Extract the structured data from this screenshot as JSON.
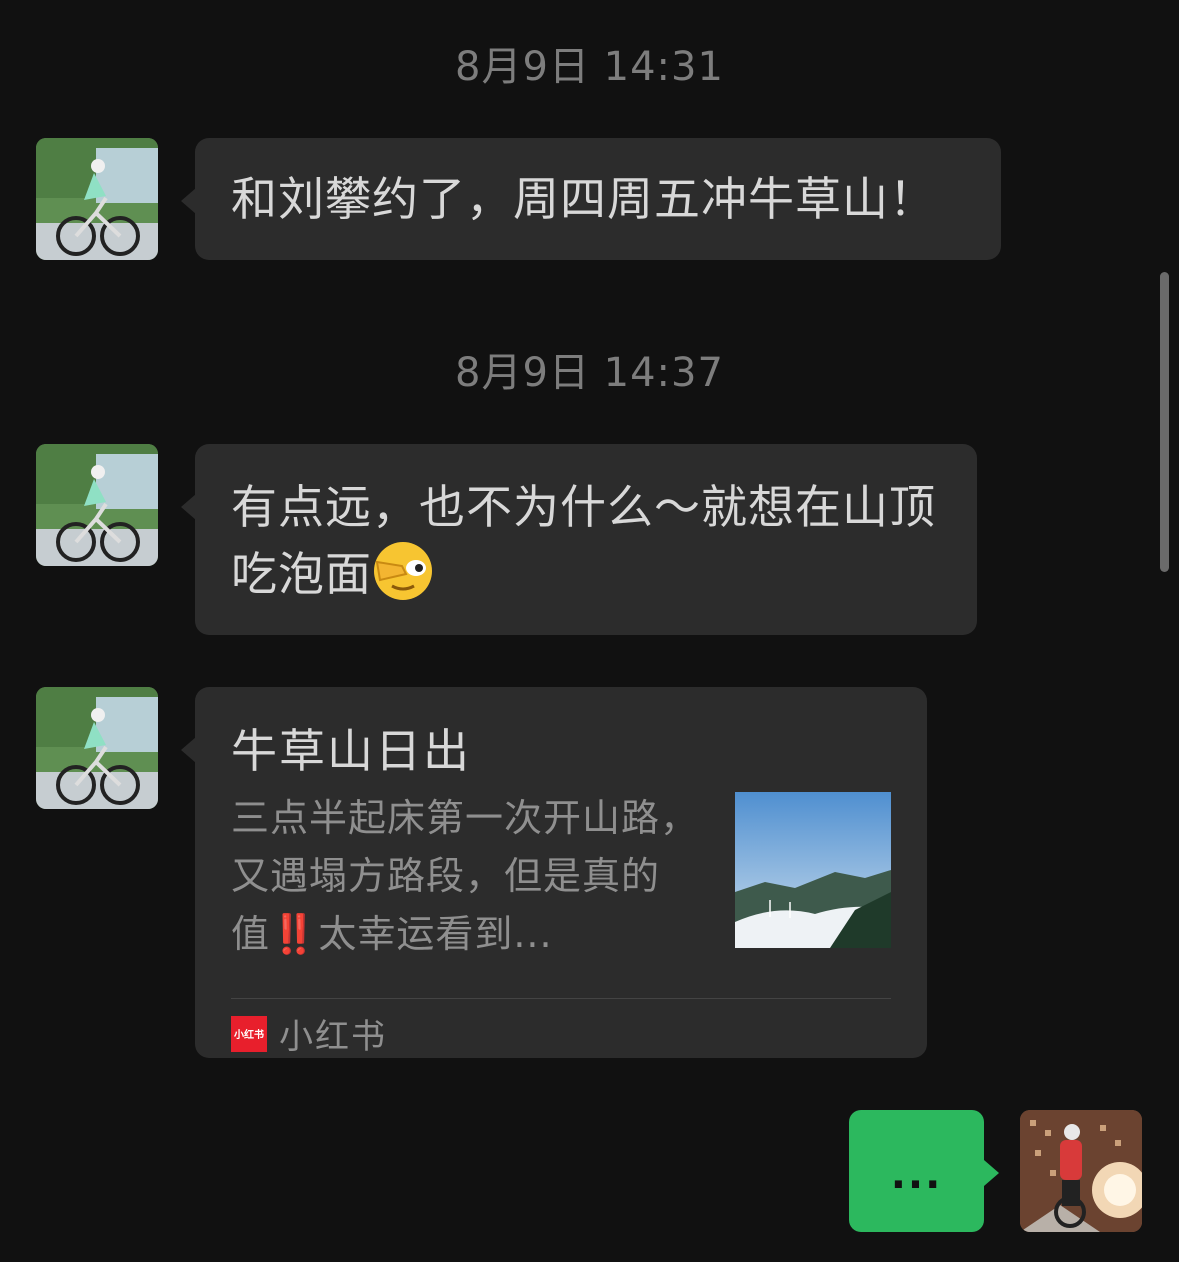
{
  "messages": [
    {
      "timestamp": "8月9日 14:31",
      "text": "和刘攀约了，周四周五冲牛草山！"
    },
    {
      "timestamp": "8月9日 14:37",
      "text": "有点远，也不为什么～就想在山顶吃泡面",
      "emoji": "face-with-hand-over-eye"
    },
    {
      "card": {
        "title": "牛草山日出",
        "desc_before": "三点半起床第一次开山路，又遇塌方路段，但是真的值",
        "desc_mark": "‼️",
        "desc_after": "太幸运看到...",
        "source_logo": "小红书",
        "source_name": "小红书"
      }
    }
  ],
  "outgoing": {
    "text": "..."
  },
  "colors": {
    "background": "#111111",
    "bubble": "#2c2c2c",
    "outgoing_bubble": "#2cb85e",
    "brand_red": "#e81f2c"
  }
}
